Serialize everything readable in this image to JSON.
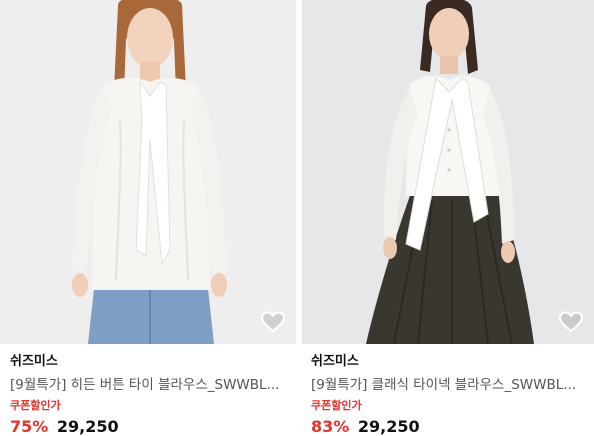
{
  "products": [
    {
      "brand": "쉬즈미스",
      "title": "[9월특가] 히든 버튼 타이 블라우스_SWWBL...",
      "coupon_label": "쿠폰할인가",
      "discount": "75%",
      "price": "29,250",
      "wishlist_icon": "heart-outline-icon",
      "image_alt": "model wearing white tie blouse and blue jeans"
    },
    {
      "brand": "쉬즈미스",
      "title": "[9월특가] 클래식 타이넥 블라우스_SWWBL...",
      "coupon_label": "쿠폰할인가",
      "discount": "83%",
      "price": "29,250",
      "wishlist_icon": "heart-outline-icon",
      "image_alt": "model wearing white tie neck blouse and dark pleated skirt"
    }
  ],
  "colors": {
    "accent": "#e2352b",
    "brand_text": "#111111",
    "title_text": "#555555"
  }
}
